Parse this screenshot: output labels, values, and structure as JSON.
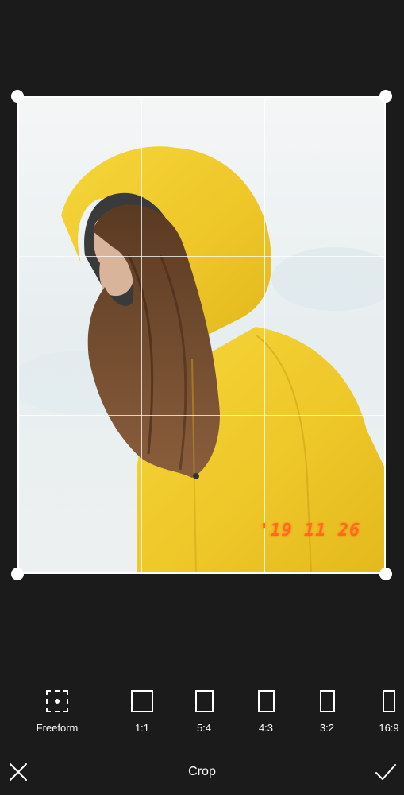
{
  "photo": {
    "date_stamp": "'19 11 26"
  },
  "ratios": [
    {
      "label": "Freeform",
      "icon": "freeform-crop-icon",
      "selected": true
    },
    {
      "label": "1:1",
      "icon": "ratio-1-1-icon",
      "selected": false
    },
    {
      "label": "5:4",
      "icon": "ratio-5-4-icon",
      "selected": false
    },
    {
      "label": "4:3",
      "icon": "ratio-4-3-icon",
      "selected": false
    },
    {
      "label": "3:2",
      "icon": "ratio-3-2-icon",
      "selected": false
    },
    {
      "label": "16:9",
      "icon": "ratio-16-9-icon",
      "selected": false
    }
  ],
  "bottom_bar": {
    "title": "Crop",
    "close_icon": "close-icon",
    "confirm_icon": "checkmark-icon"
  },
  "colors": {
    "background": "#1b1b1c",
    "date_stamp": "#ff6a1e",
    "jacket": "#f2cf2e"
  }
}
